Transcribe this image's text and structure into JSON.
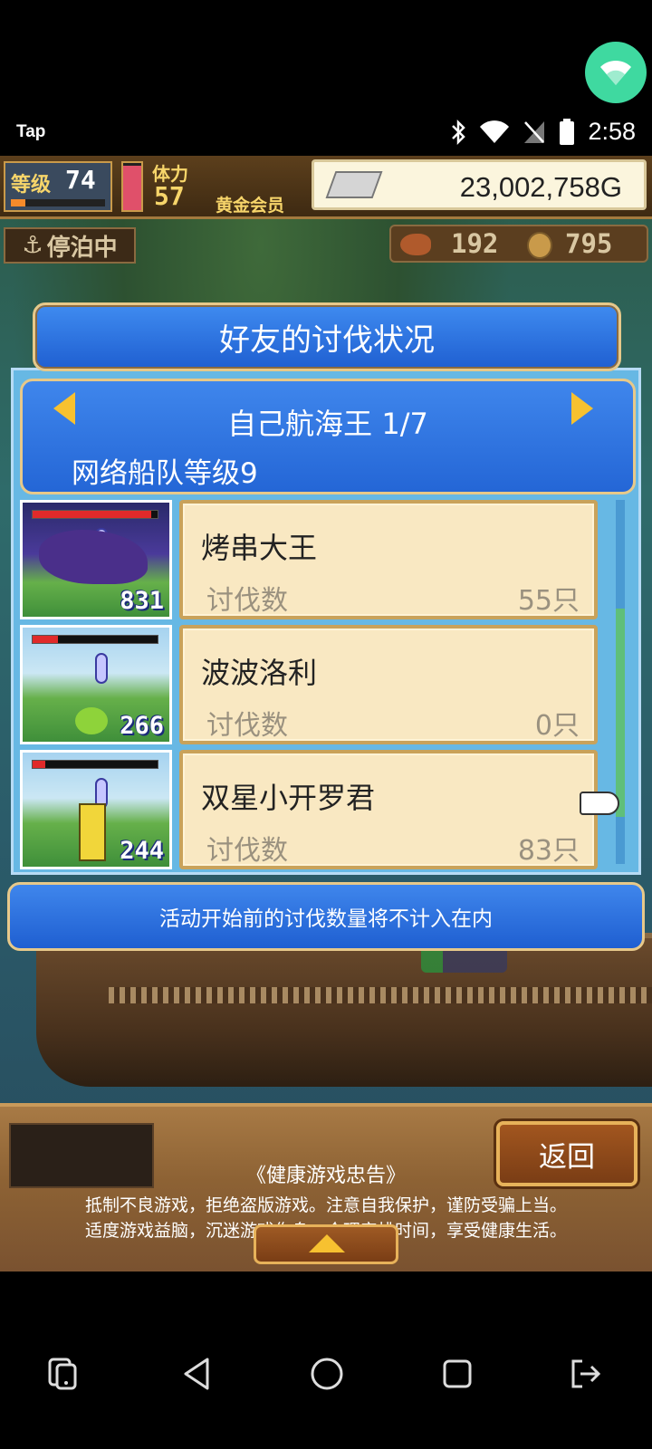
{
  "status_bar": {
    "app_label": "Tap",
    "time": "2:58",
    "icons": [
      "bluetooth-icon",
      "wifi-icon",
      "no-sim-icon",
      "battery-icon"
    ],
    "bubble_icon": "wifi-icon"
  },
  "hud": {
    "level_label": "等级",
    "level_value": "74",
    "level_progress": 0.15,
    "hp_level": 0.95,
    "stamina_label": "体力",
    "stamina_value": "57",
    "member_label": "黄金会员",
    "gold": "23,002,758G",
    "docked_label": "停泊中",
    "food": "192",
    "coins": "795"
  },
  "modal": {
    "title": "好友的讨伐状况",
    "fleet_title": "自己航海王 1/7",
    "fleet_level": "网络船队等级9",
    "rows": [
      {
        "name": "烤串大王",
        "label": "讨伐数",
        "count": "55只",
        "monster_count": "831",
        "hp": 0.95
      },
      {
        "name": "波波洛利",
        "label": "讨伐数",
        "count": "0只",
        "monster_count": "266",
        "hp": 0.2
      },
      {
        "name": "双星小开罗君",
        "label": "讨伐数",
        "count": "83只",
        "monster_count": "244",
        "hp": 0.1
      }
    ],
    "notice": "活动开始前的讨伐数量将不计入在内",
    "scroll_position": 0.7
  },
  "footer": {
    "back_label": "返回",
    "advisory_title": "《健康游戏忠告》",
    "advisory_line1": "抵制不良游戏，拒绝盗版游戏。注意自我保护，谨防受骗上当。",
    "advisory_line2": "适度游戏益脑，沉迷游戏伤身。合理安排时间，享受健康生活。"
  },
  "navbar": {
    "icons": [
      "screenshot-icon",
      "back-icon",
      "home-icon",
      "recents-icon",
      "exit-icon"
    ]
  },
  "colors": {
    "panel_blue": "#2466d6",
    "card_bg": "#f9e8c2",
    "accent_gold": "#f7c130"
  }
}
